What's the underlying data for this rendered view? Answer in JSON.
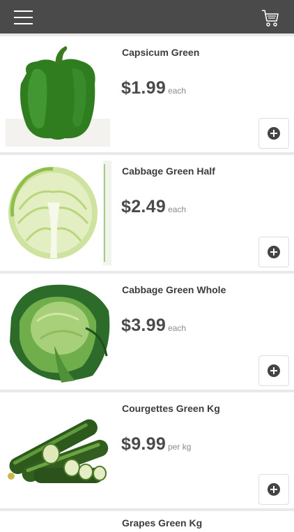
{
  "header": {
    "menu_icon": "hamburger-menu-icon",
    "cart_icon": "shopping-cart-icon",
    "background": "#4a4a4a"
  },
  "products": [
    {
      "name": "Capsicum Green",
      "price": "$1.99",
      "unit": "each",
      "image": "green-capsicum"
    },
    {
      "name": "Cabbage Green Half",
      "price": "$2.49",
      "unit": "each",
      "image": "half-cabbage"
    },
    {
      "name": "Cabbage Green Whole",
      "price": "$3.99",
      "unit": "each",
      "image": "whole-cabbage"
    },
    {
      "name": "Courgettes Green Kg",
      "price": "$9.99",
      "unit": "per kg",
      "image": "courgettes"
    }
  ],
  "partial_product": {
    "name": "Grapes Green Kg"
  }
}
